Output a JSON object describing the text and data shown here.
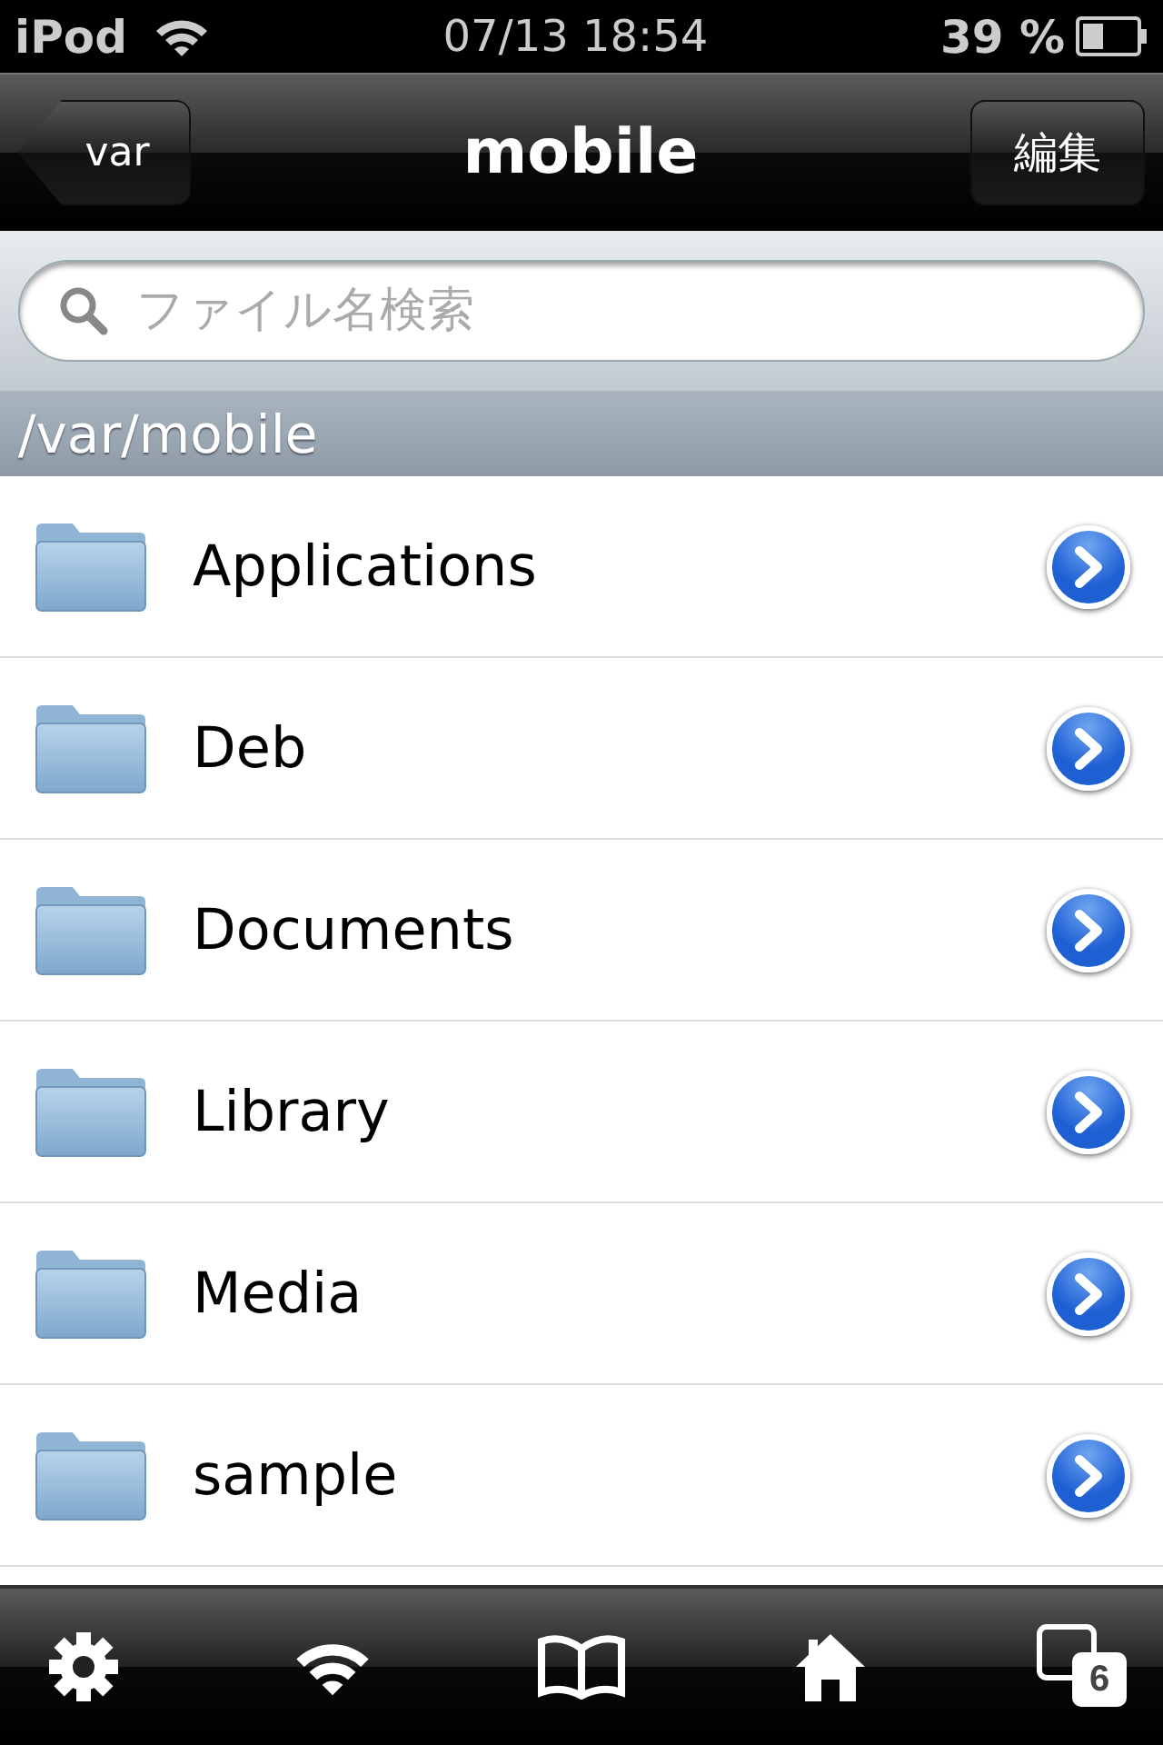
{
  "status_bar": {
    "carrier": "iPod",
    "time": "07/13 18:54",
    "battery": "39 %"
  },
  "nav_bar": {
    "back": "var",
    "title": "mobile",
    "edit": "編集"
  },
  "search": {
    "placeholder": "ファイル名検索"
  },
  "path": "/var/mobile",
  "items": [
    {
      "name": "Applications"
    },
    {
      "name": "Deb"
    },
    {
      "name": "Documents"
    },
    {
      "name": "Library"
    },
    {
      "name": "Media"
    },
    {
      "name": "sample"
    }
  ],
  "toolbar": {
    "windows_count": "6"
  }
}
